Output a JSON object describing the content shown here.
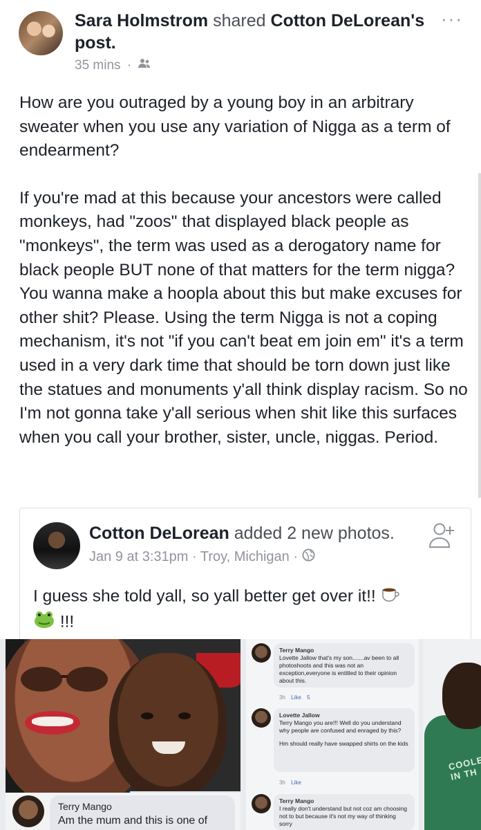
{
  "header": {
    "sharer_name": "Sara Holmstrom",
    "shared_verb": "shared",
    "original_author_possessive": "Cotton DeLorean's",
    "object": "post.",
    "time": "35 mins",
    "separator": "·",
    "audience_icon": "people-icon",
    "more_label": "···"
  },
  "post": {
    "paragraph_1": "How are you outraged by a young boy in an arbitrary sweater when you use any variation of Nigga as a term of endearment?",
    "paragraph_2": "If you're mad at this because your ancestors were called monkeys, had \"zoos\" that displayed black people as \"monkeys\", the term was used as a derogatory name for black people BUT none of that matters for the term nigga? You wanna make a hoopla about this but make excuses for other shit? Please. Using the term Nigga is not a coping mechanism, it's not \"if you can't beat em join em\" it's a term used in a very dark time that should be torn down just like the statues and monuments y'all think display racism. So no I'm not gonna take y'all serious when shit like this surfaces when you call your brother, sister, uncle, niggas. Period."
  },
  "shared_post": {
    "author": "Cotton DeLorean",
    "action": "added 2 new photos.",
    "date": "Jan 9 at 3:31pm",
    "location": "Troy, Michigan",
    "separator": "·",
    "privacy_icon": "globe-icon",
    "text": "I guess she told yall, so yall better get over it!!",
    "trailing": "!!!",
    "add_friend_icon": "add-friend-icon"
  },
  "photo_comments": {
    "bottom_left": {
      "name": "Terry Mango",
      "text": "Am the mum and this is one of"
    },
    "items": [
      {
        "name": "Terry Mango",
        "text": "Lovette Jallow that's my son.......av been to all photoshoots and this was not an exception,everyone is entitled to their opinion about this.",
        "time": "3h",
        "like": "Like",
        "reactions": "5"
      },
      {
        "name": "Lovette Jallow",
        "text": "Terry Mango you are!!! Well do you understand why people are confused and enraged by this?",
        "text_2": "Hm should really have swapped shirts on the kids",
        "time": "3h",
        "like": "Like"
      },
      {
        "name": "Terry Mango",
        "text": "I really don't understand but not coz am choosing not to but because it's not my way of thinking sorry"
      }
    ],
    "hoodie_text": "COOLEST IN TH"
  },
  "colors": {
    "text": "#1d2129",
    "muted": "#90949c",
    "link_blue": "#4267b2",
    "border": "#dddfe2"
  }
}
